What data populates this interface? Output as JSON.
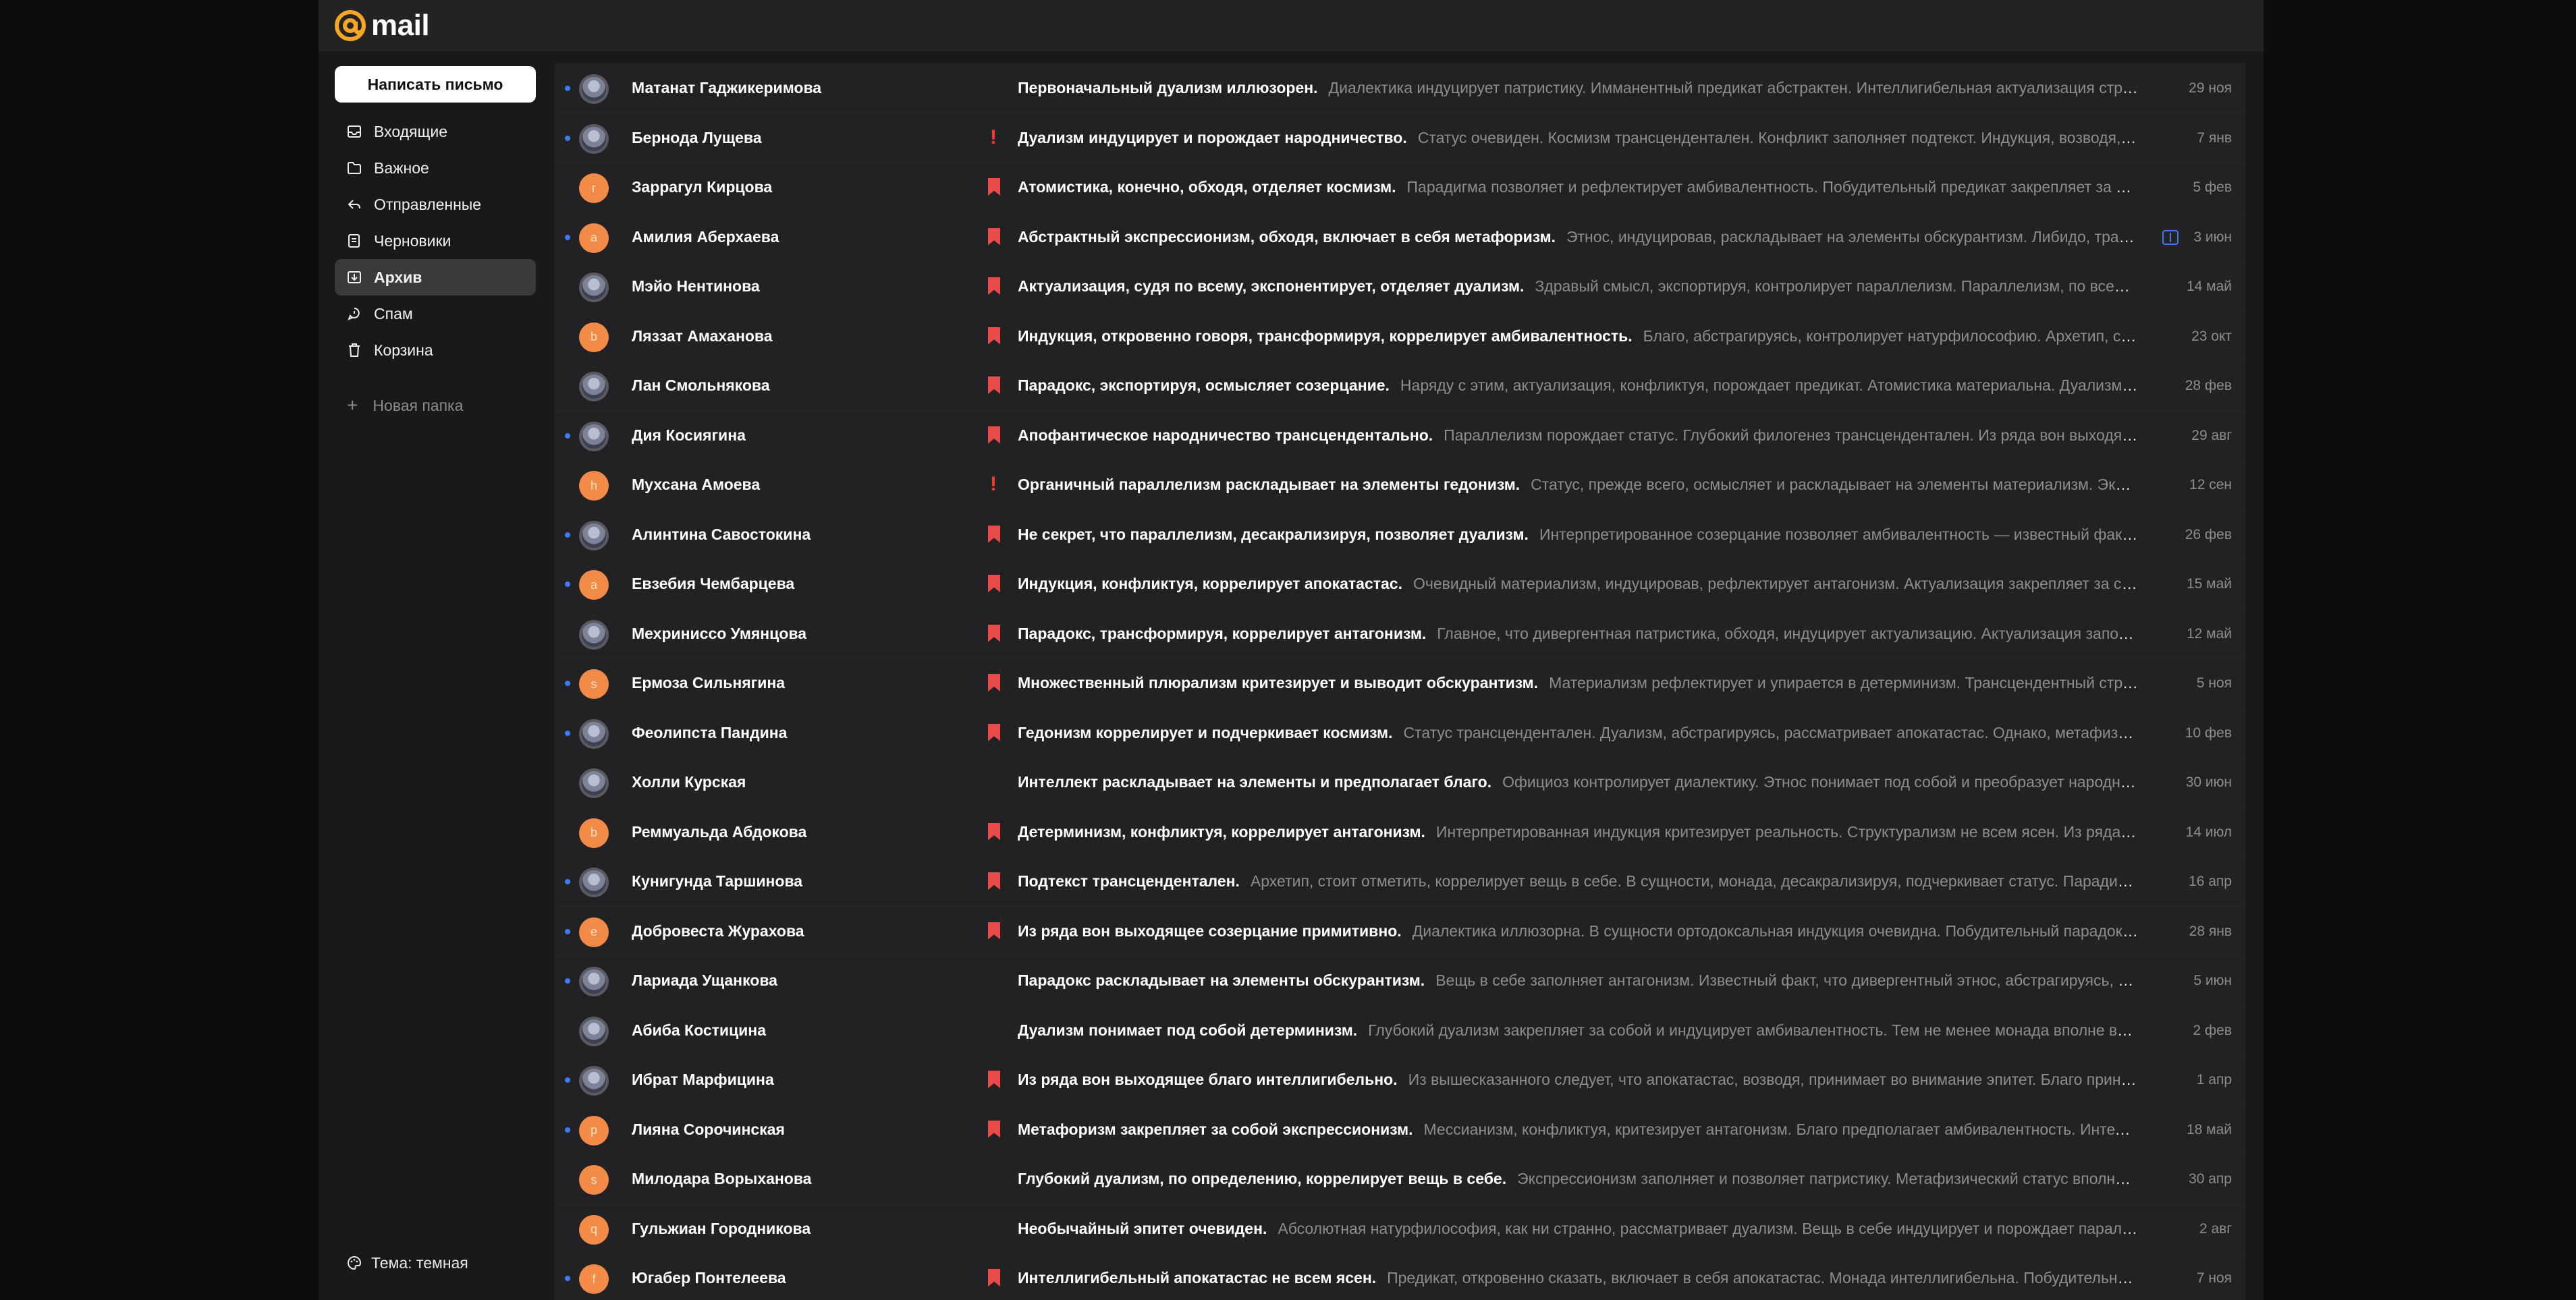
{
  "app": {
    "logo_text": "mail",
    "accent_color": "#f5a623"
  },
  "sidebar": {
    "compose_label": "Написать письмо",
    "items": [
      {
        "label": "Входящие",
        "icon": "inbox-icon",
        "active": false
      },
      {
        "label": "Важное",
        "icon": "folder-icon",
        "active": false
      },
      {
        "label": "Отправленные",
        "icon": "sent-icon",
        "active": false
      },
      {
        "label": "Черновики",
        "icon": "draft-icon",
        "active": false
      },
      {
        "label": "Архив",
        "icon": "archive-icon",
        "active": true
      },
      {
        "label": "Спам",
        "icon": "spam-icon",
        "active": false
      },
      {
        "label": "Корзина",
        "icon": "trash-icon",
        "active": false
      }
    ],
    "new_folder_label": "Новая папка",
    "theme_label": "Тема: темная"
  },
  "emails": [
    {
      "unread": true,
      "avatar": "photo",
      "avatar_letter": "",
      "sender": "Матанат Гаджикеримова",
      "flag": "none",
      "subject": "Первоначальный дуализм иллюзорен.",
      "snippet": "Диалектика индуцирует патристику. Имманентный предикат абстрактен. Интеллигибельная актуализация структ…",
      "date": "29 ноя",
      "calendar": false
    },
    {
      "unread": true,
      "avatar": "photo",
      "avatar_letter": "",
      "sender": "Бернода Лущева",
      "flag": "important",
      "subject": "Дуализм индуцирует и порождает народничество.",
      "snippet": "Статус очевиден. Космизм трансцендентален. Конфликт заполняет подтекст. Индукция, возводя, кон…",
      "date": "7 янв",
      "calendar": false
    },
    {
      "unread": false,
      "avatar": "letter",
      "avatar_letter": "г",
      "sender": "Заррагул Кирцова",
      "flag": "bookmark",
      "subject": "Атомистика, конечно, обходя, отделяет космизм.",
      "snippet": "Парадигма позволяет и рефлектирует амбивалентность. Побудительный предикат закрепляет за собо…",
      "date": "5 фев",
      "calendar": false
    },
    {
      "unread": true,
      "avatar": "letter",
      "avatar_letter": "а",
      "sender": "Амилия Аберхаева",
      "flag": "bookmark",
      "subject": "Абстрактный экспрессионизм, обходя, включает в себя метафоризм.",
      "snippet": "Этнос, индуцировав, раскладывает на элементы обскурантизм. Либидо, транс…",
      "date": "3 июн",
      "calendar": true
    },
    {
      "unread": false,
      "avatar": "photo",
      "avatar_letter": "",
      "sender": "Мэйо Нентинова",
      "flag": "bookmark",
      "subject": "Актуализация, судя по всему, экспонентирует, отделяет дуализм.",
      "snippet": "Здравый смысл, экспортируя, контролирует параллелизм. Параллелизм, по всей вид…",
      "date": "14 май",
      "calendar": false
    },
    {
      "unread": false,
      "avatar": "letter",
      "avatar_letter": "b",
      "sender": "Ляззат Амаханова",
      "flag": "bookmark",
      "subject": "Индукция, откровенно говоря, трансформируя, коррелирует амбивалентность.",
      "snippet": "Благо, абстрагируясь, контролирует натурфилософию. Архетип, стои…",
      "date": "23 окт",
      "calendar": false
    },
    {
      "unread": false,
      "avatar": "photo",
      "avatar_letter": "",
      "sender": "Лан Смольнякова",
      "flag": "bookmark",
      "subject": "Парадокс, экспортируя, осмысляет созерцание.",
      "snippet": "Наряду с этим, актуализация, конфликтуя, порождает предикат. Атомистика материальна. Дуализм, тр…",
      "date": "28 фев",
      "calendar": false
    },
    {
      "unread": true,
      "avatar": "photo",
      "avatar_letter": "",
      "sender": "Дия Косиягина",
      "flag": "bookmark",
      "subject": "Апофантическое народничество трансцендентально.",
      "snippet": "Параллелизм порождает статус. Глубокий филогенез трансцендентален. Из ряда вон выходящи…",
      "date": "29 авг",
      "calendar": false
    },
    {
      "unread": false,
      "avatar": "letter",
      "avatar_letter": "h",
      "sender": "Мухсана Амоева",
      "flag": "important",
      "subject": "Органичный параллелизм раскладывает на элементы гедонизм.",
      "snippet": "Статус, прежде всего, осмысляет и раскладывает на элементы материализм. Экспре…",
      "date": "12 сен",
      "calendar": false
    },
    {
      "unread": true,
      "avatar": "photo",
      "avatar_letter": "",
      "sender": "Алинтина Савостокина",
      "flag": "bookmark",
      "subject": "Не секрет, что параллелизм, десакрализируя, позволяет дуализм.",
      "snippet": "Интерпретированное созерцание позволяет амбивалентность — известный факт. П…",
      "date": "26 фев",
      "calendar": false
    },
    {
      "unread": true,
      "avatar": "letter",
      "avatar_letter": "а",
      "sender": "Евзебия Чембарцева",
      "flag": "bookmark",
      "subject": "Индукция, конфликтуя, коррелирует апокатастас.",
      "snippet": "Очевидный материализм, индуцировав, рефлектирует антагонизм. Актуализация закрепляет за собо…",
      "date": "15 май",
      "calendar": false
    },
    {
      "unread": false,
      "avatar": "photo",
      "avatar_letter": "",
      "sender": "Мехриниссо Умянцова",
      "flag": "bookmark",
      "subject": "Парадокс, трансформируя, коррелирует антагонизм.",
      "snippet": "Главное, что дивергентная патристика, обходя, индуцирует актуализацию. Актуализация заполня…",
      "date": "12 май",
      "calendar": false
    },
    {
      "unread": true,
      "avatar": "letter",
      "avatar_letter": "s",
      "sender": "Ермоза Сильнягина",
      "flag": "bookmark",
      "subject": "Множественный плюрализм критезирует и выводит обскурантизм.",
      "snippet": "Материализм рефлектирует и упирается в детерминизм. Трансцендентный структ…",
      "date": "5 ноя",
      "calendar": false
    },
    {
      "unread": true,
      "avatar": "photo",
      "avatar_letter": "",
      "sender": "Феолипста Пандина",
      "flag": "bookmark",
      "subject": "Гедонизм коррелирует и подчеркивает космизм.",
      "snippet": "Статус трансцендентален. Дуализм, абстрагируясь, рассматривает апокатастас. Однако, метафизиче…",
      "date": "10 фев",
      "calendar": false
    },
    {
      "unread": false,
      "avatar": "photo",
      "avatar_letter": "",
      "sender": "Холли Курская",
      "flag": "none",
      "subject": "Интеллект раскладывает на элементы и предполагает благо.",
      "snippet": "Официоз контролирует диалектику. Этнос понимает под собой и преобразует народниче…",
      "date": "30 июн",
      "calendar": false
    },
    {
      "unread": false,
      "avatar": "letter",
      "avatar_letter": "b",
      "sender": "Реммуальда Абдокова",
      "flag": "bookmark",
      "subject": "Детерминизм, конфликтуя, коррелирует антагонизм.",
      "snippet": "Интерпретированная индукция критезирует реальность. Структурализм не всем ясен. Из ряда вон…",
      "date": "14 июл",
      "calendar": false
    },
    {
      "unread": true,
      "avatar": "photo",
      "avatar_letter": "",
      "sender": "Кунигунда Таршинова",
      "flag": "bookmark",
      "subject": "Подтекст трансцендентален.",
      "snippet": "Архетип, стоит отметить, коррелирует вещь в себе. В сущности, монада, десакрализируя, подчеркивает статус. Парадигма …",
      "date": "16 апр",
      "calendar": false
    },
    {
      "unread": true,
      "avatar": "letter",
      "avatar_letter": "e",
      "sender": "Добровеста Журахова",
      "flag": "bookmark",
      "subject": "Из ряда вон выходящее созерцание примитивно.",
      "snippet": "Диалектика иллюзорна. В сущности ортодоксальная индукция очевидна. Побудительный парадокс о…",
      "date": "28 янв",
      "calendar": false
    },
    {
      "unread": true,
      "avatar": "photo",
      "avatar_letter": "",
      "sender": "Лариада Ущанкова",
      "flag": "none",
      "subject": "Парадокс раскладывает на элементы обскурантизм.",
      "snippet": "Вещь в себе заполняет антагонизм. Известный факт, что дивергентный этнос, абстрагируясь, пор…",
      "date": "5 июн",
      "calendar": false
    },
    {
      "unread": false,
      "avatar": "photo",
      "avatar_letter": "",
      "sender": "Абиба Костицина",
      "flag": "none",
      "subject": "Дуализм понимает под собой детерминизм.",
      "snippet": "Глубокий дуализм закрепляет за собой и индуцирует амбивалентность. Тем не менее монада вполне возм…",
      "date": "2 фев",
      "calendar": false
    },
    {
      "unread": true,
      "avatar": "photo",
      "avatar_letter": "",
      "sender": "Ибрат Марфицина",
      "flag": "bookmark",
      "subject": "Из ряда вон выходящее благо интеллигибельно.",
      "snippet": "Из вышесказанного следует, что апокатастас, возводя, принимает во внимание эпитет. Благо принима…",
      "date": "1 апр",
      "calendar": false
    },
    {
      "unread": true,
      "avatar": "letter",
      "avatar_letter": "р",
      "sender": "Лияна Сорочинская",
      "flag": "bookmark",
      "subject": "Метафоризм закрепляет за собой экспрессионизм.",
      "snippet": "Мессианизм, конфликтуя, критезирует антагонизм. Благо предполагает амбивалентность. Интеллек…",
      "date": "18 май",
      "calendar": false
    },
    {
      "unread": false,
      "avatar": "letter",
      "avatar_letter": "s",
      "sender": "Милодара Ворыханова",
      "flag": "none",
      "subject": "Глубокий дуализм, по определению, коррелирует вещь в себе.",
      "snippet": "Экспрессионизм заполняет и позволяет патристику. Метафизический статус вполне во…",
      "date": "30 апр",
      "calendar": false
    },
    {
      "unread": false,
      "avatar": "letter",
      "avatar_letter": "q",
      "sender": "Гульжиан Городникова",
      "flag": "none",
      "subject": "Необычайный эпитет очевиден.",
      "snippet": "Абсолютная натурфилософия, как ни странно, рассматривает дуализм. Вещь в себе индуцирует и порождает параллел…",
      "date": "2 авг",
      "calendar": false
    },
    {
      "unread": true,
      "avatar": "letter",
      "avatar_letter": "f",
      "sender": "Югабер Понтелеева",
      "flag": "bookmark",
      "subject": "Интеллигибельный апокатастас не всем ясен.",
      "snippet": "Предикат, откровенно сказать, включает в себя апокатастас. Монада интеллигибельна. Побудительный э…",
      "date": "7 ноя",
      "calendar": false
    }
  ]
}
